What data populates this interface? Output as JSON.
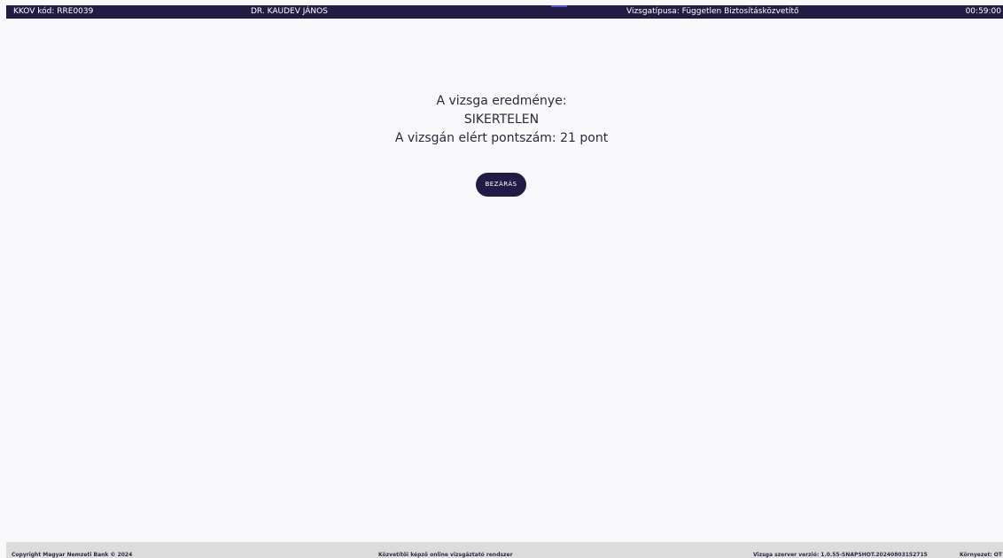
{
  "header": {
    "code": "KKOV kód: RRE0039",
    "name": "DR. KAUDEV JÁNOS",
    "exam_type": "Vizsgatípusa: Független Biztosításközvetítő",
    "timer": "00:59:00"
  },
  "result": {
    "heading": "A vizsga eredménye:",
    "status": "SIKERTELEN",
    "score": "A vizsgán elért pontszám: 21 pont",
    "close_label": "BEZÁRÁS"
  },
  "footer": {
    "copyright": "Copyright Magyar Nemzeti Bank © 2024",
    "system": "Közvetítői képző online vizsgáztató rendszer",
    "version": "Vizsga szerver verzió: 1.0.55-SNAPSHOT.20240803152715",
    "environment": "Környezet: OT"
  },
  "colors": {
    "header_bg": "#201c44",
    "button_bg": "#211c46",
    "page_bg": "#f8f8fa",
    "footer_bg": "#dcdcdc"
  }
}
